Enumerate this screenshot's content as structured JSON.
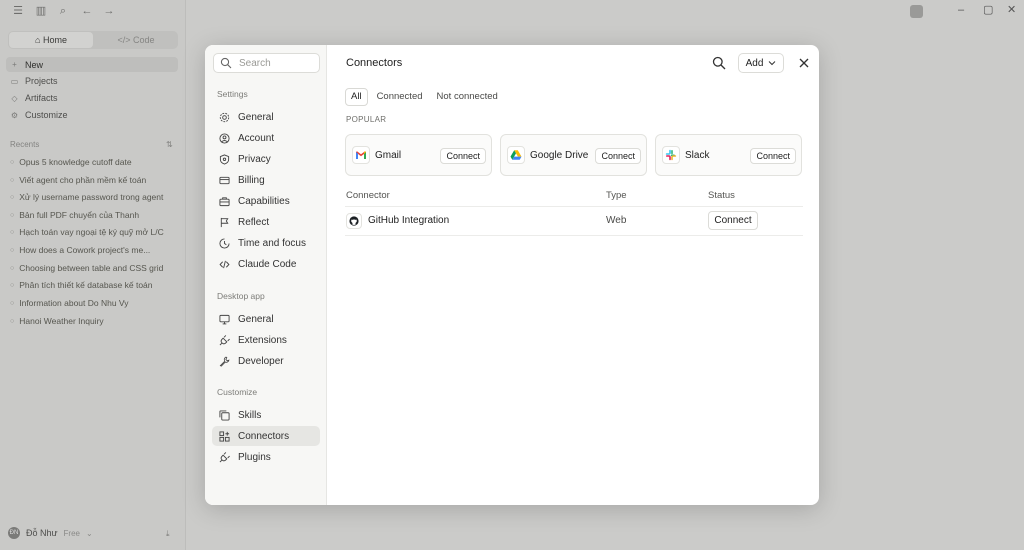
{
  "background_app": {
    "mode_tabs": [
      "Home",
      "Code"
    ],
    "nav": [
      "New",
      "Projects",
      "Artifacts",
      "Customize"
    ],
    "recents_label": "Recents",
    "recents": [
      "Opus 5 knowledge cutoff date",
      "Viết agent cho phần mềm kế toán",
      "Xử lý username password trong agent",
      "Bản full PDF chuyển của Thanh",
      "Hạch toán vay ngoại tệ ký quỹ mở L/C",
      "How does a Cowork project's me...",
      "Choosing between table and CSS grid",
      "Phân tích thiết kế database kế toán",
      "Information about Do Nhu Vy",
      "Hanoi Weather Inquiry"
    ],
    "user": {
      "initials": "ĐN",
      "name": "Đỗ Như",
      "plan": "Free"
    }
  },
  "settings_nav": {
    "search_placeholder": "Search",
    "groups": [
      {
        "label": "Settings",
        "items": [
          "General",
          "Account",
          "Privacy",
          "Billing",
          "Capabilities",
          "Reflect",
          "Time and focus",
          "Claude Code"
        ]
      },
      {
        "label": "Desktop app",
        "items": [
          "General",
          "Extensions",
          "Developer"
        ]
      },
      {
        "label": "Customize",
        "items": [
          "Skills",
          "Connectors",
          "Plugins"
        ]
      }
    ],
    "active_item": "Connectors"
  },
  "connectors": {
    "title": "Connectors",
    "add_label": "Add",
    "tabs": [
      "All",
      "Connected",
      "Not connected"
    ],
    "active_tab": "All",
    "popular_label": "POPULAR",
    "popular": [
      {
        "name": "Gmail",
        "icon": "gmail-icon",
        "button": "Connect"
      },
      {
        "name": "Google Drive",
        "icon": "google-drive-icon",
        "button": "Connect"
      },
      {
        "name": "Slack",
        "icon": "slack-icon",
        "button": "Connect"
      }
    ],
    "table": {
      "headers": [
        "Connector",
        "Type",
        "Status"
      ],
      "rows": [
        {
          "name": "GitHub Integration",
          "icon": "github-icon",
          "type": "Web",
          "status_button": "Connect"
        }
      ]
    }
  },
  "colors": {
    "overlay": "#8f8f8c",
    "modal_bg": "#ffffff",
    "nav_bg": "#f7f7f5",
    "active_item_bg": "#e6e6e3"
  }
}
